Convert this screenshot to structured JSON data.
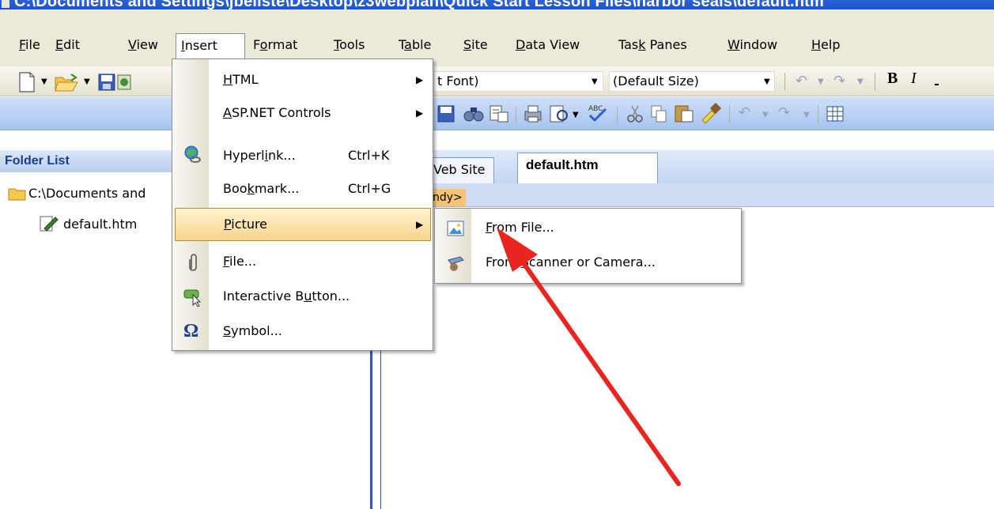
{
  "window": {
    "title": "C:\\Documents and Settings\\jbeliste\\Desktop\\z3webplan\\Quick Start Lesson Files\\harbor seals\\default.htm"
  },
  "menubar": {
    "items": [
      {
        "label": "File",
        "u": "F",
        "rest": "ile"
      },
      {
        "label": "Edit",
        "u": "E",
        "rest": "dit"
      },
      {
        "label": "View",
        "u": "V",
        "rest": "iew"
      },
      {
        "label": "Insert",
        "u": "I",
        "rest": "nsert"
      },
      {
        "label": "Format",
        "pre": "F",
        "u": "o",
        "rest": "rmat"
      },
      {
        "label": "Tools",
        "u": "T",
        "rest": "ools"
      },
      {
        "label": "Table",
        "pre": "T",
        "u": "a",
        "rest": "ble"
      },
      {
        "label": "Site",
        "u": "S",
        "rest": "ite"
      },
      {
        "label": "Data View",
        "u": "D",
        "rest": "ata View"
      },
      {
        "label": "Task Panes",
        "pre": "Tas",
        "u": "k",
        "rest": " Panes"
      },
      {
        "label": "Window",
        "u": "W",
        "rest": "indow"
      },
      {
        "label": "Help",
        "u": "H",
        "rest": "elp"
      }
    ]
  },
  "toolbar": {
    "font_value": "t Font)",
    "size_value": "(Default Size)",
    "bold": "B",
    "italic": "I"
  },
  "folder_list": {
    "header": "Folder List",
    "root": "C:\\Documents and",
    "file": "default.htm"
  },
  "editor": {
    "tab_web": "Web Site",
    "tab_web_visible": "Veb Site",
    "tab_default": "default.htm",
    "crumb": "<body>",
    "crumb_visible": "ndy>"
  },
  "insert_menu": {
    "items": [
      {
        "pre": "",
        "u": "H",
        "rest": "TML",
        "shortcut": "",
        "submenu": true,
        "icon": ""
      },
      {
        "pre": "",
        "u": "A",
        "rest": "SP.NET Controls",
        "shortcut": "",
        "submenu": true,
        "icon": ""
      },
      {
        "pre": "Hyperl",
        "u": "i",
        "rest": "nk...",
        "shortcut": "Ctrl+K",
        "submenu": false,
        "icon": "hyperlink-icon"
      },
      {
        "pre": "Boo",
        "u": "k",
        "rest": "mark...",
        "shortcut": "Ctrl+G",
        "submenu": false,
        "icon": ""
      },
      {
        "pre": "",
        "u": "P",
        "rest": "icture",
        "shortcut": "",
        "submenu": true,
        "icon": ""
      },
      {
        "pre": "",
        "u": "F",
        "rest": "ile...",
        "shortcut": "",
        "submenu": false,
        "icon": "paperclip-icon"
      },
      {
        "pre": "Interactive B",
        "u": "u",
        "rest": "tton...",
        "shortcut": "",
        "submenu": false,
        "icon": "interactive-button-icon"
      },
      {
        "pre": "",
        "u": "S",
        "rest": "ymbol...",
        "shortcut": "",
        "submenu": false,
        "icon": "omega-icon"
      }
    ]
  },
  "picture_submenu": {
    "items": [
      {
        "pre": "",
        "u": "F",
        "rest": "rom File...",
        "icon": "picture-from-file-icon"
      },
      {
        "pre": "From ",
        "u": "S",
        "rest": "canner or Camera...",
        "icon": "scanner-camera-icon"
      }
    ]
  },
  "colors": {
    "titlebar": "#1d54c8",
    "menu_hover": "#f9d48d",
    "annotation_arrow": "#e8251f"
  }
}
